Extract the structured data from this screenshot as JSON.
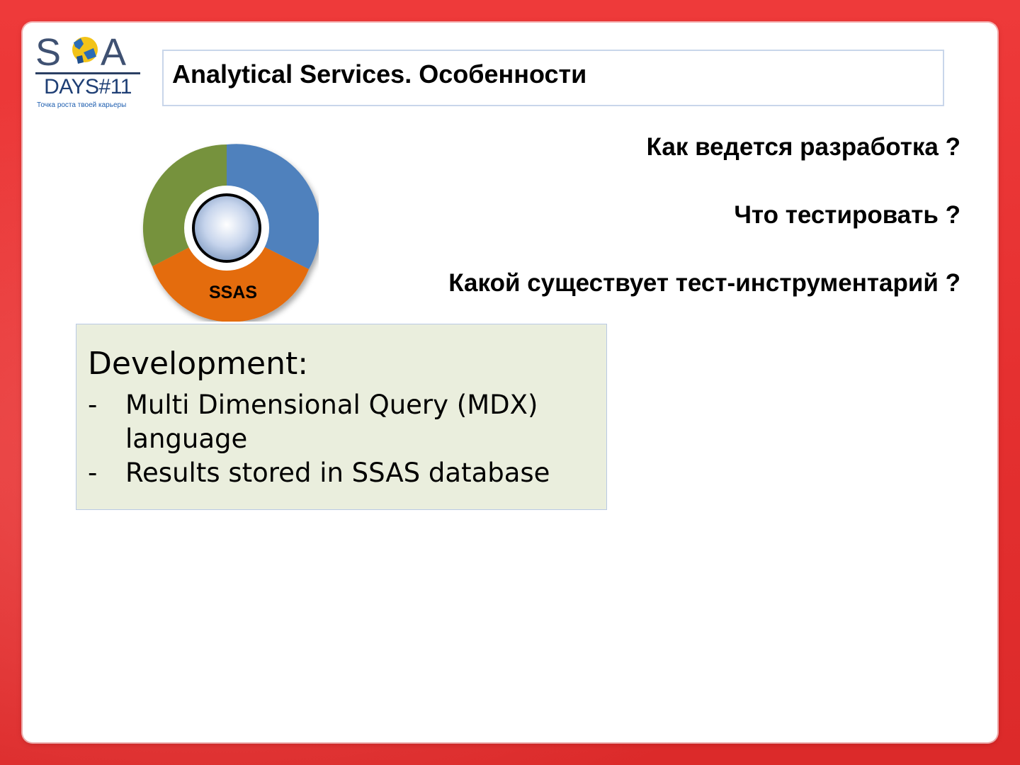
{
  "logo": {
    "letters": "SQA",
    "days": "DAYS#11",
    "tagline": "Точка роста твоей карьеры"
  },
  "title": "Analytical Services. Особенности",
  "questions": [
    "Как ведется разработка ?",
    "Что тестировать ?",
    "Какой существует тест-инструментарий ?"
  ],
  "diagram": {
    "label": "SSAS",
    "segment_colors": [
      "#4f81bd",
      "#e46c0a",
      "#76923c"
    ]
  },
  "development": {
    "heading": "Development:",
    "items": [
      {
        "bullet": "-",
        "text": "Multi Dimensional Query (MDX) language"
      },
      {
        "bullet": "-",
        "text": "Results stored in SSAS database"
      }
    ]
  },
  "colors": {
    "frame": "#e53030",
    "title_border": "#c9d6ea",
    "dev_box_bg": "#eaeedd",
    "dev_box_border": "#b9c9e4"
  }
}
